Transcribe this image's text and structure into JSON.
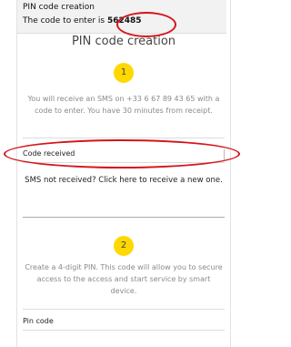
{
  "notification": {
    "title": "PIN code creation",
    "message_prefix": "The code to enter is",
    "code": "562485"
  },
  "page": {
    "title": "PIN code creation"
  },
  "step1": {
    "number": "1",
    "description": "You will receive an SMS on +33 6 67 89 43 65 with a code to enter. You have 30 minutes from receipt."
  },
  "code_field": {
    "label": "Code received"
  },
  "resend": {
    "label": "SMS not received? Click here to receive a new one."
  },
  "step2": {
    "number": "2",
    "description": "Create a 4-digit PIN. This code will allow you to secure access to the access and start service by smart device."
  },
  "pin_field": {
    "label": "Pin code"
  },
  "colors": {
    "step_badge": "#ffd800",
    "highlight": "#d4141c"
  }
}
